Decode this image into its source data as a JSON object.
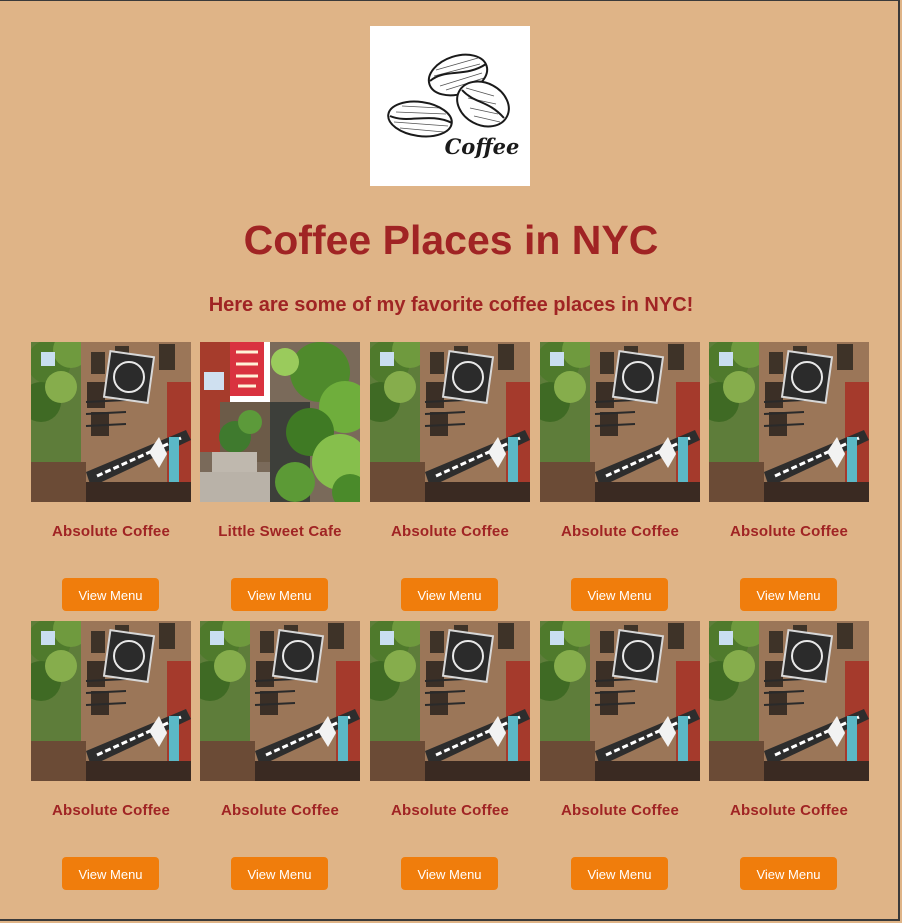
{
  "logo": {
    "text": "Coffee",
    "icon": "coffee-beans-logo"
  },
  "header": {
    "title": "Coffee Places in NYC",
    "subtitle": "Here are some of my favorite coffee places in NYC!"
  },
  "cafes": [
    {
      "name": "Absolute Coffee",
      "button": "View Menu",
      "photo": "absolute-coffee-storefront"
    },
    {
      "name": "Little Sweet Cafe",
      "button": "View Menu",
      "photo": "little-sweet-cafe-storefront"
    },
    {
      "name": "Absolute Coffee",
      "button": "View Menu",
      "photo": "absolute-coffee-storefront"
    },
    {
      "name": "Absolute Coffee",
      "button": "View Menu",
      "photo": "absolute-coffee-storefront"
    },
    {
      "name": "Absolute Coffee",
      "button": "View Menu",
      "photo": "absolute-coffee-storefront"
    },
    {
      "name": "Absolute Coffee",
      "button": "View Menu",
      "photo": "absolute-coffee-storefront"
    },
    {
      "name": "Absolute Coffee",
      "button": "View Menu",
      "photo": "absolute-coffee-storefront"
    },
    {
      "name": "Absolute Coffee",
      "button": "View Menu",
      "photo": "absolute-coffee-storefront"
    },
    {
      "name": "Absolute Coffee",
      "button": "View Menu",
      "photo": "absolute-coffee-storefront"
    },
    {
      "name": "Absolute Coffee",
      "button": "View Menu",
      "photo": "absolute-coffee-storefront"
    }
  ],
  "colors": {
    "background": "#dfb487",
    "heading": "#a02424",
    "button": "#f07d0c",
    "button_text": "#ffffff"
  }
}
